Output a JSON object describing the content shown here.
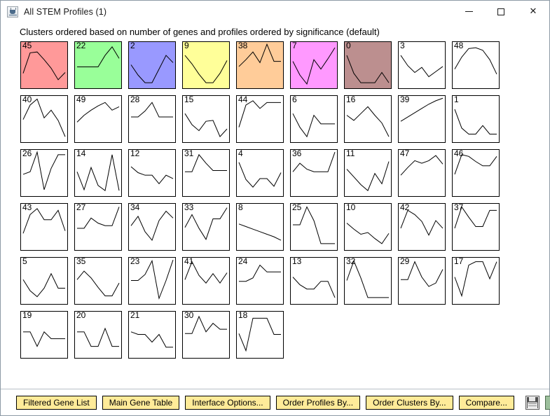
{
  "window": {
    "title": "All STEM Profiles (1)",
    "app_icon": "java-coffee-cup-icon",
    "controls": {
      "minimize": "minimize-icon",
      "maximize": "maximize-icon",
      "close": "✕"
    }
  },
  "caption": "Clusters ordered based on number of genes and profiles ordered by significance (default)",
  "colors": {
    "profile_fill_1": "#ff9999",
    "profile_fill_2": "#99ff99",
    "profile_fill_3": "#9999ff",
    "profile_fill_4": "#ffff99",
    "profile_fill_5": "#ffcc99",
    "profile_fill_6": "#ff99ff",
    "profile_fill_7": "#bc8f8f",
    "profile_fill_none": "#ffffff",
    "button_fill": "#ffeb99",
    "help_icon_fill": "#9cbf9c",
    "line": "#000000"
  },
  "toolbar": {
    "buttons": [
      {
        "label": "Filtered Gene List",
        "name": "filtered-gene-list-button"
      },
      {
        "label": "Main Gene Table",
        "name": "main-gene-table-button"
      },
      {
        "label": "Interface Options...",
        "name": "interface-options-button"
      },
      {
        "label": "Order Profiles By...",
        "name": "order-profiles-by-button"
      },
      {
        "label": "Order Clusters By...",
        "name": "order-clusters-by-button"
      },
      {
        "label": "Compare...",
        "name": "compare-button"
      }
    ],
    "save_icon": "save-floppy-icon",
    "help_icon": "help-question-icon"
  },
  "chart_data": {
    "type": "line",
    "title": "All STEM Profiles (1)",
    "description": "Grid of 49 small multiple gene-expression profile thumbnails. Each cell shows a profile ID and a polyline of relative expression across 7 time points. Colored cells are statistically significant clusters.",
    "xlabel": "",
    "ylabel": "",
    "grid": false,
    "legend": "none",
    "columns": 9,
    "rows": 6,
    "ylim": [
      0,
      100
    ],
    "x": [
      0,
      1,
      2,
      3,
      4,
      5,
      6
    ],
    "profiles": [
      {
        "id": "45",
        "color": "#ff9999",
        "values": [
          30,
          78,
          80,
          62,
          42,
          15,
          32
        ]
      },
      {
        "id": "22",
        "color": "#99ff99",
        "values": [
          45,
          45,
          45,
          45,
          72,
          92,
          65
        ]
      },
      {
        "id": "2",
        "color": "#9999ff",
        "values": [
          50,
          26,
          8,
          8,
          40,
          72,
          55
        ]
      },
      {
        "id": "9",
        "color": "#ffff99",
        "values": [
          72,
          52,
          28,
          8,
          8,
          30,
          60
        ]
      },
      {
        "id": "38",
        "color": "#ffcc99",
        "values": [
          46,
          62,
          80,
          55,
          98,
          58,
          58
        ]
      },
      {
        "id": "7",
        "color": "#ff99ff",
        "values": [
          58,
          26,
          5,
          62,
          40,
          64,
          90
        ]
      },
      {
        "id": "0",
        "color": "#bc8f8f",
        "values": [
          72,
          30,
          8,
          8,
          8,
          32,
          8
        ]
      },
      {
        "id": "3",
        "color": "#ffffff",
        "values": [
          72,
          48,
          32,
          44,
          22,
          34,
          46
        ]
      },
      {
        "id": "48",
        "color": "#ffffff",
        "values": [
          40,
          68,
          88,
          90,
          84,
          62,
          28
        ]
      },
      {
        "id": "40",
        "color": "#ffffff",
        "values": [
          48,
          82,
          96,
          52,
          70,
          46,
          8
        ]
      },
      {
        "id": "49",
        "color": "#ffffff",
        "values": [
          42,
          58,
          70,
          80,
          88,
          70,
          78
        ]
      },
      {
        "id": "28",
        "color": "#ffffff",
        "values": [
          54,
          54,
          68,
          88,
          54,
          54,
          54
        ]
      },
      {
        "id": "15",
        "color": "#ffffff",
        "values": [
          62,
          36,
          22,
          44,
          46,
          8,
          26
        ]
      },
      {
        "id": "44",
        "color": "#ffffff",
        "values": [
          30,
          82,
          92,
          74,
          88,
          88,
          88
        ]
      },
      {
        "id": "6",
        "color": "#ffffff",
        "values": [
          62,
          30,
          8,
          58,
          38,
          38,
          38
        ]
      },
      {
        "id": "16",
        "color": "#ffffff",
        "values": [
          58,
          46,
          62,
          78,
          58,
          40,
          8
        ]
      },
      {
        "id": "39",
        "color": "#ffffff",
        "values": [
          44,
          54,
          64,
          74,
          84,
          92,
          98
        ]
      },
      {
        "id": "1",
        "color": "#ffffff",
        "values": [
          72,
          28,
          14,
          14,
          34,
          14,
          14
        ]
      },
      {
        "id": "26",
        "color": "#ffffff",
        "values": [
          46,
          52,
          98,
          10,
          60,
          92,
          92
        ]
      },
      {
        "id": "14",
        "color": "#ffffff",
        "values": [
          52,
          10,
          62,
          20,
          8,
          92,
          8
        ]
      },
      {
        "id": "12",
        "color": "#ffffff",
        "values": [
          64,
          50,
          44,
          44,
          24,
          44,
          36
        ]
      },
      {
        "id": "31",
        "color": "#ffffff",
        "values": [
          52,
          52,
          92,
          72,
          55,
          55,
          55
        ]
      },
      {
        "id": "4",
        "color": "#ffffff",
        "values": [
          74,
          34,
          16,
          36,
          36,
          18,
          50
        ]
      },
      {
        "id": "36",
        "color": "#ffffff",
        "values": [
          52,
          72,
          58,
          52,
          52,
          52,
          98
        ]
      },
      {
        "id": "11",
        "color": "#ffffff",
        "values": [
          58,
          40,
          22,
          8,
          48,
          24,
          76
        ]
      },
      {
        "id": "47",
        "color": "#ffffff",
        "values": [
          44,
          62,
          78,
          72,
          78,
          90,
          70
        ]
      },
      {
        "id": "46",
        "color": "#ffffff",
        "values": [
          46,
          92,
          88,
          76,
          66,
          66,
          88
        ]
      },
      {
        "id": "43",
        "color": "#ffffff",
        "values": [
          34,
          78,
          92,
          66,
          66,
          88,
          40
        ]
      },
      {
        "id": "27",
        "color": "#ffffff",
        "values": [
          46,
          46,
          70,
          58,
          52,
          52,
          96
        ]
      },
      {
        "id": "34",
        "color": "#ffffff",
        "values": [
          52,
          74,
          38,
          18,
          64,
          86,
          70
        ]
      },
      {
        "id": "33",
        "color": "#ffffff",
        "values": [
          48,
          78,
          46,
          20,
          68,
          68,
          94
        ]
      },
      {
        "id": "8",
        "color": "#ffffff",
        "values": [
          56,
          50,
          44,
          38,
          32,
          26,
          18
        ]
      },
      {
        "id": "25",
        "color": "#ffffff",
        "values": [
          54,
          54,
          96,
          64,
          10,
          10,
          10
        ]
      },
      {
        "id": "10",
        "color": "#ffffff",
        "values": [
          58,
          44,
          32,
          36,
          22,
          10,
          34
        ]
      },
      {
        "id": "42",
        "color": "#ffffff",
        "values": [
          46,
          88,
          78,
          62,
          30,
          64,
          46
        ]
      },
      {
        "id": "37",
        "color": "#ffffff",
        "values": [
          46,
          96,
          72,
          50,
          50,
          88,
          88
        ]
      },
      {
        "id": "5",
        "color": "#ffffff",
        "values": [
          52,
          26,
          12,
          32,
          66,
          32,
          32
        ]
      },
      {
        "id": "35",
        "color": "#ffffff",
        "values": [
          52,
          72,
          56,
          34,
          14,
          14,
          44
        ]
      },
      {
        "id": "23",
        "color": "#ffffff",
        "values": [
          50,
          50,
          64,
          96,
          8,
          50,
          98
        ]
      },
      {
        "id": "41",
        "color": "#ffffff",
        "values": [
          52,
          94,
          62,
          44,
          66,
          44,
          68
        ]
      },
      {
        "id": "24",
        "color": "#ffffff",
        "values": [
          48,
          48,
          56,
          86,
          70,
          70,
          70
        ]
      },
      {
        "id": "13",
        "color": "#ffffff",
        "values": [
          58,
          40,
          30,
          30,
          48,
          48,
          10
        ]
      },
      {
        "id": "32",
        "color": "#ffffff",
        "values": [
          50,
          96,
          56,
          10,
          10,
          10,
          10
        ]
      },
      {
        "id": "29",
        "color": "#ffffff",
        "values": [
          52,
          52,
          94,
          58,
          36,
          44,
          76
        ]
      },
      {
        "id": "17",
        "color": "#ffffff",
        "values": [
          58,
          14,
          86,
          94,
          94,
          54,
          94
        ]
      },
      {
        "id": "19",
        "color": "#ffffff",
        "values": [
          56,
          56,
          22,
          56,
          40,
          40,
          40
        ]
      },
      {
        "id": "20",
        "color": "#ffffff",
        "values": [
          56,
          56,
          22,
          22,
          64,
          22,
          22
        ]
      },
      {
        "id": "21",
        "color": "#ffffff",
        "values": [
          56,
          50,
          50,
          32,
          50,
          20,
          20
        ]
      },
      {
        "id": "30",
        "color": "#ffffff",
        "values": [
          52,
          52,
          92,
          56,
          76,
          62,
          62
        ]
      },
      {
        "id": "18",
        "color": "#ffffff",
        "values": [
          52,
          12,
          88,
          88,
          88,
          50,
          50
        ]
      }
    ]
  }
}
